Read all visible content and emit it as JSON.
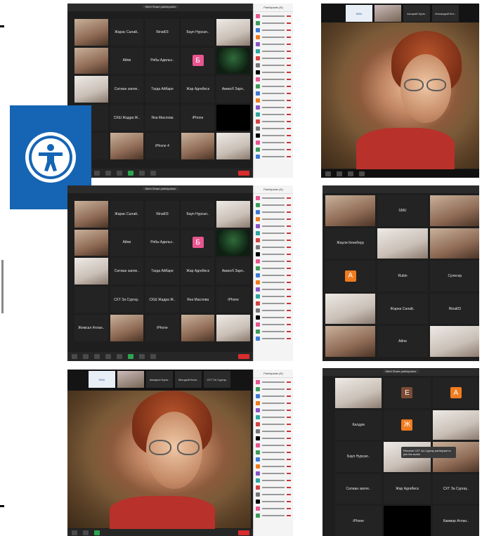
{
  "panel_tl": {
    "window_label": "Meet Share participation",
    "grid": [
      {
        "label": "",
        "type": "photo"
      },
      {
        "label": "Жарас Салай..",
        "type": "name"
      },
      {
        "label": "Rinat03",
        "type": "name"
      },
      {
        "label": "Бауп Нурсап..",
        "type": "name"
      },
      {
        "label": "",
        "type": "photo-light"
      },
      {
        "label": "",
        "type": "photo"
      },
      {
        "label": "Айпи",
        "type": "name"
      },
      {
        "label": "Рябы Адильх..",
        "type": "name"
      },
      {
        "label": "Б",
        "type": "avatar"
      },
      {
        "label": "",
        "type": "photo-green"
      },
      {
        "label": "",
        "type": "photo-light"
      },
      {
        "label": "Сатжан запле..",
        "type": "name"
      },
      {
        "label": "Тагда Айбаре",
        "type": "name"
      },
      {
        "label": "Жар Адгибеск",
        "type": "name"
      },
      {
        "label": "Акмесб Зарл..",
        "type": "name"
      },
      {
        "label": "",
        "type": "name"
      },
      {
        "label": "СХШ Жадра Ж..",
        "type": "name"
      },
      {
        "label": "Яна Маслова",
        "type": "name"
      },
      {
        "label": "iPhone",
        "type": "name"
      },
      {
        "label": "",
        "type": "black"
      },
      {
        "label": "",
        "type": "name"
      },
      {
        "label": "",
        "type": "photo"
      },
      {
        "label": "iPhone 4",
        "type": "name"
      },
      {
        "label": "",
        "type": "photo"
      },
      {
        "label": "",
        "type": "photo-light"
      }
    ],
    "participants_title": "Participants (N)"
  },
  "panel_ml": {
    "window_label": "Meet Share participation",
    "grid": [
      {
        "label": "",
        "type": "photo"
      },
      {
        "label": "Жарас Салай..",
        "type": "name"
      },
      {
        "label": "Rinat03",
        "type": "name"
      },
      {
        "label": "Бауп Нурсап..",
        "type": "name"
      },
      {
        "label": "",
        "type": "photo-light"
      },
      {
        "label": "",
        "type": "photo"
      },
      {
        "label": "Айпи",
        "type": "name"
      },
      {
        "label": "Рябы Адильх..",
        "type": "name"
      },
      {
        "label": "Б",
        "type": "avatar"
      },
      {
        "label": "",
        "type": "photo-green"
      },
      {
        "label": "",
        "type": "photo-light"
      },
      {
        "label": "Сатжан запле..",
        "type": "name"
      },
      {
        "label": "Тагда Айбаре",
        "type": "name"
      },
      {
        "label": "Жар Адгибеск",
        "type": "name"
      },
      {
        "label": "Акмесб Зарл..",
        "type": "name"
      },
      {
        "label": "",
        "type": "name"
      },
      {
        "label": "СХТ За Сургау..",
        "type": "name"
      },
      {
        "label": "СХШ Жадра Ж..",
        "type": "name"
      },
      {
        "label": "Яна Маслова",
        "type": "name"
      },
      {
        "label": "iPhone",
        "type": "name"
      },
      {
        "label": "Жемсал Атлан..",
        "type": "name"
      },
      {
        "label": "",
        "type": "photo"
      },
      {
        "label": "iPhone",
        "type": "name"
      },
      {
        "label": "",
        "type": "photo"
      },
      {
        "label": "",
        "type": "photo-light"
      }
    ],
    "participants_title": "Participants (N)"
  },
  "panel_bl": {
    "strip": [
      "SMU",
      "",
      "Акмарал Кусм..",
      "Мылдый Кесв..",
      "СХТ Зп Сургау.."
    ],
    "participants_title": "Participants (N)"
  },
  "panel_tr": {
    "strip": [
      "SMU",
      "",
      "Аксарай Кусм..",
      "Ильмадый Кес..",
      "СХТ За Сургау.."
    ]
  },
  "panel_mr": {
    "grid": [
      {
        "label": "",
        "type": "photo"
      },
      {
        "label": "SMU",
        "type": "name"
      },
      {
        "label": "",
        "type": "photo"
      },
      {
        "label": "Жаули Кенеберу",
        "type": "name"
      },
      {
        "label": "",
        "type": "photo-light"
      },
      {
        "label": "",
        "type": "photo"
      },
      {
        "label": "А",
        "type": "avatar-orange"
      },
      {
        "label": "Rubin",
        "type": "name"
      },
      {
        "label": "Сулесер",
        "type": "name"
      },
      {
        "label": "",
        "type": "photo-light"
      },
      {
        "label": "Жарна Салай..",
        "type": "name"
      },
      {
        "label": "Rinat03",
        "type": "name"
      },
      {
        "label": "",
        "type": "photo"
      },
      {
        "label": "Айпи",
        "type": "name"
      },
      {
        "label": "",
        "type": "photo-light"
      }
    ]
  },
  "panel_br": {
    "window_label": "Meet Share participation",
    "grid": [
      {
        "label": "",
        "type": "photo-light"
      },
      {
        "label": "Е",
        "type": "avatar-brown"
      },
      {
        "label": "А",
        "type": "avatar-orange"
      },
      {
        "label": "Калдум",
        "type": "name"
      },
      {
        "label": "Ж",
        "type": "avatar-orange"
      },
      {
        "label": "",
        "type": "photo-light"
      },
      {
        "label": "Бауп Нурсап..",
        "type": "name"
      },
      {
        "label": "",
        "type": "photo-light"
      },
      {
        "label": "",
        "type": "photo"
      },
      {
        "label": "Сатжан запле..",
        "type": "name"
      },
      {
        "label": "Жар Адгибеск",
        "type": "name"
      },
      {
        "label": "СХТ За Сургау..",
        "type": "name"
      },
      {
        "label": "iPhone",
        "type": "name"
      },
      {
        "label": "",
        "type": "black"
      },
      {
        "label": "Каммар Атлан..",
        "type": "name"
      }
    ],
    "tooltip": "Rename СХТ Ас-Сургау participant to join the audio"
  },
  "colors": {
    "accessibility_blue": "#1565b4",
    "end_red": "#d92d2d",
    "avatar_pink": "#e8568f",
    "avatar_orange": "#f07c1f",
    "avatar_brown": "#7a4b35"
  },
  "icons": {
    "accessibility": "accessibility-person-icon"
  }
}
